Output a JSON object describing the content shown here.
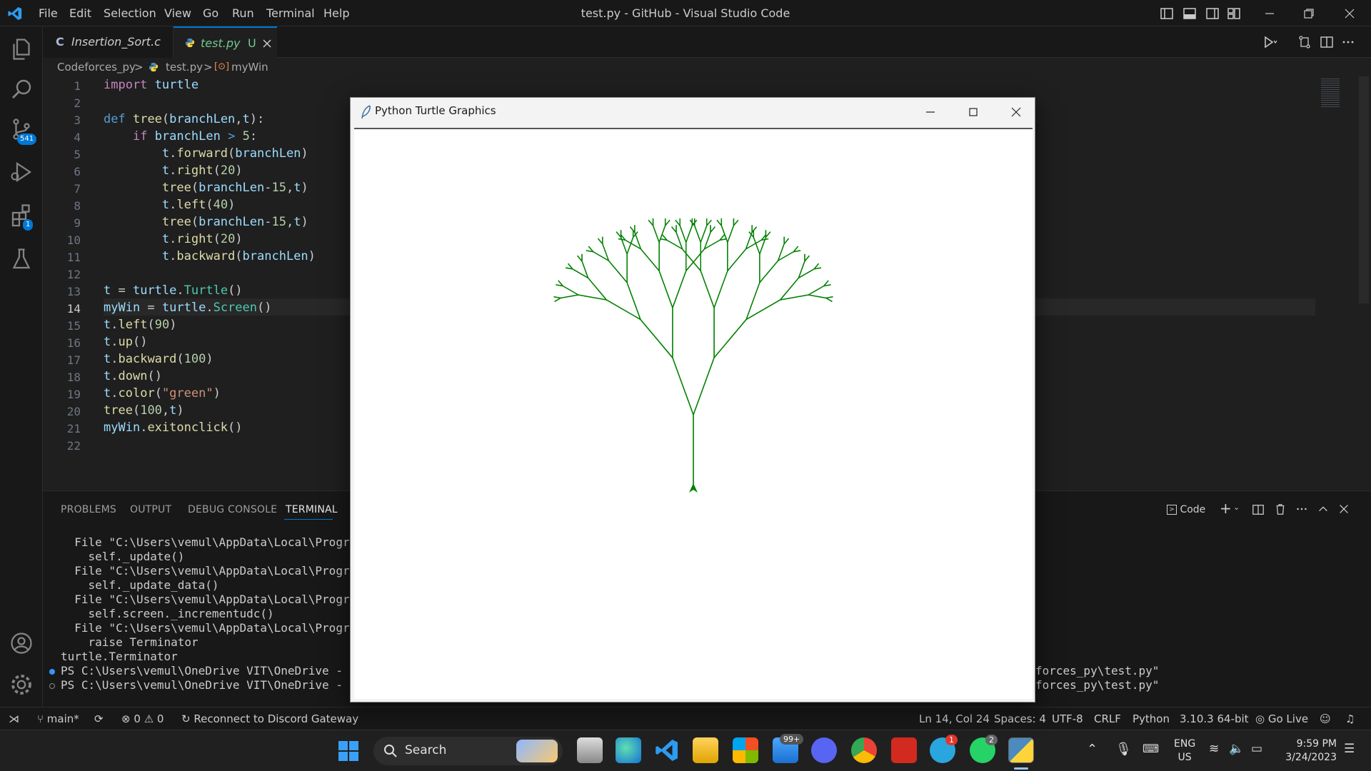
{
  "app": {
    "window_title": "test.py - GitHub - Visual Studio Code",
    "menu": [
      "File",
      "Edit",
      "Selection",
      "View",
      "Go",
      "Run",
      "Terminal",
      "Help"
    ]
  },
  "activity_bar": {
    "scm_badge": "541",
    "extensions_badge": "1"
  },
  "tabs": [
    {
      "label": "Insertion_Sort.c",
      "icon_text": "C",
      "active": false
    },
    {
      "label": "test.py",
      "status": "U",
      "active": true
    }
  ],
  "breadcrumb": {
    "folder": "Codeforces_py",
    "file": "test.py",
    "symbol": "myWin"
  },
  "editor": {
    "active_line": 14,
    "lines": [
      "import turtle",
      "",
      "def tree(branchLen,t):",
      "    if branchLen > 5:",
      "        t.forward(branchLen)",
      "        t.right(20)",
      "        tree(branchLen-15,t)",
      "        t.left(40)",
      "        tree(branchLen-15,t)",
      "        t.right(20)",
      "        t.backward(branchLen)",
      "",
      "t = turtle.Turtle()",
      "myWin = turtle.Screen()",
      "t.left(90)",
      "t.up()",
      "t.backward(100)",
      "t.down()",
      "t.color(\"green\")",
      "tree(100,t)",
      "myWin.exitonclick()",
      ""
    ]
  },
  "panel": {
    "tabs": [
      "PROBLEMS",
      "OUTPUT",
      "DEBUG CONSOLE",
      "TERMINAL"
    ],
    "active_tab": "TERMINAL",
    "terminal_profile": "Code",
    "terminal_lines": [
      "  File \"C:\\Users\\vemul\\AppData\\Local\\Programs",
      "    self._update()",
      "  File \"C:\\Users\\vemul\\AppData\\Local\\Programs",
      "    self._update_data()",
      "  File \"C:\\Users\\vemul\\AppData\\Local\\Programs",
      "    self.screen._incrementudc()",
      "  File \"C:\\Users\\vemul\\AppData\\Local\\Programs",
      "    raise Terminator",
      "turtle.Terminator"
    ],
    "prompt_lines": [
      {
        "left": "PS C:\\Users\\vemul\\OneDrive VIT\\OneDrive - vit",
        "right": "forces_py\\test.py\""
      },
      {
        "left": "PS C:\\Users\\vemul\\OneDrive VIT\\OneDrive - vit",
        "right": "forces_py\\test.py\""
      }
    ]
  },
  "turtle_window": {
    "title": "Python Turtle Graphics",
    "pen_color": "#008000"
  },
  "status_bar": {
    "branch": "main*",
    "errors": "0",
    "warnings": "0",
    "discord": "Reconnect to Discord Gateway",
    "position": "Ln 14, Col 24",
    "spaces": "Spaces: 4",
    "encoding": "UTF-8",
    "eol": "CRLF",
    "language": "Python",
    "interpreter": "3.10.3 64-bit",
    "golive": "Go Live"
  },
  "taskbar": {
    "search_label": "Search",
    "mail_badge": "99+",
    "telegram_badge": "1",
    "whatsapp_badge": "2",
    "lang_top": "ENG",
    "lang_bottom": "US",
    "time": "9:59 PM",
    "date": "3/24/2023"
  },
  "colors": {
    "accent": "#0078d4",
    "tree": "#008000"
  }
}
